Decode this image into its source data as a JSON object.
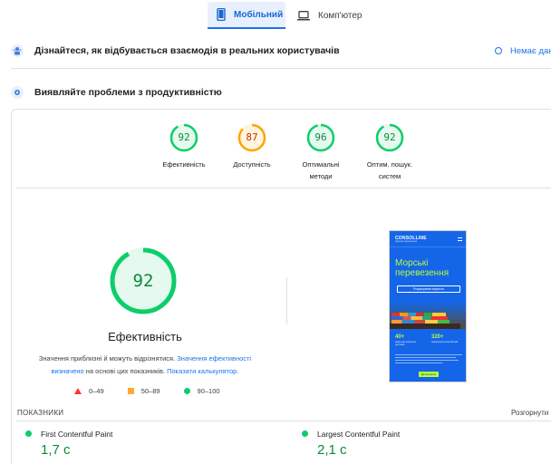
{
  "tabs": {
    "mobile": "Мобільний",
    "desktop": "Комп'ютер"
  },
  "field_data": {
    "title": "Дізнайтеся, як відбувається взаємодія в реальних користувачів",
    "link": "Немає дан"
  },
  "lab_data": {
    "title": "Виявляйте проблеми з продуктивністю"
  },
  "scores": [
    {
      "label": "Ефективність",
      "value": "92",
      "score": 92,
      "color": "#0cce6b",
      "text_color": "#0c8a3a"
    },
    {
      "label": "Доступність",
      "value": "87",
      "score": 87,
      "color": "#ffa400",
      "text_color": "#c33300"
    },
    {
      "label_1": "Оптимальні",
      "label_2": "методи",
      "value": "96",
      "score": 96,
      "color": "#0cce6b",
      "text_color": "#0c8a3a"
    },
    {
      "label_1": "Оптим. пошук.",
      "label_2": "систем",
      "value": "92",
      "score": 92,
      "color": "#0cce6b",
      "text_color": "#0c8a3a"
    }
  ],
  "performance": {
    "score": "92",
    "score_value": 92,
    "title": "Ефективність",
    "desc_1": "Значення приблизні й можуть відрізнятися.",
    "desc_link_1": "Значення ефективності визначено",
    "desc_2": "на основі цих показників.",
    "desc_link_2": "Показати калькулятор."
  },
  "legend": {
    "bad": "0–49",
    "average": "50–89",
    "good": "90–100"
  },
  "screenshot": {
    "logo": "CONSOLLINE",
    "logo_sub": "морські перевезення",
    "headline": "Морські перевезення",
    "cta": "Розрахувати вартість",
    "stat1_num": "40+",
    "stat1_text": "країн-партнерів для доставки",
    "stat2_num": "320+",
    "stat2_text": "перевезених контейнерів",
    "button": "Детальніше"
  },
  "metrics": {
    "header": "ПОКАЗНИКИ",
    "expand": "Розгорнути",
    "items": [
      {
        "name": "First Contentful Paint",
        "value": "1,7 с"
      },
      {
        "name": "Largest Contentful Paint",
        "value": "2,1 с"
      }
    ]
  },
  "colors": {
    "good": "#0cce6b",
    "average": "#ffa400",
    "bad": "#ff3333",
    "accent": "#1a73e8"
  }
}
